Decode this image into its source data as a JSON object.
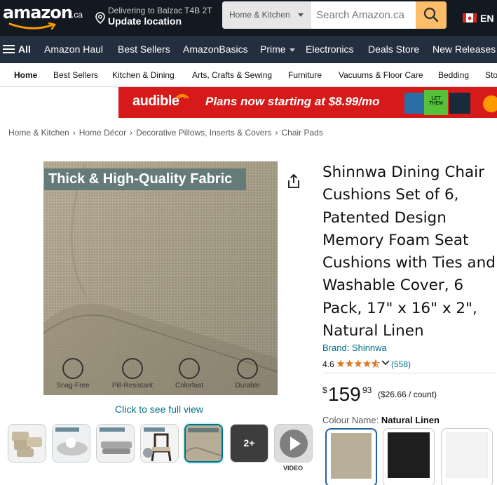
{
  "header": {
    "logo_text": "amazon",
    "logo_tld": ".ca",
    "location_line1": "Delivering to Balzac T4B 2T",
    "location_line2": "Update location",
    "search_category": "Home & Kitchen",
    "search_placeholder": "Search Amazon.ca",
    "language": "EN"
  },
  "nav": {
    "all_label": "All",
    "items": [
      "Amazon Haul",
      "Best Sellers",
      "AmazonBasics",
      "Prime",
      "Electronics",
      "Deals Store",
      "New Releases"
    ]
  },
  "subnav": {
    "items": [
      "Home",
      "Best Sellers",
      "Kitchen & Dining",
      "Arts, Crafts & Sewing",
      "Furniture",
      "Vacuums & Floor Care",
      "Bedding",
      "Sto"
    ]
  },
  "banner": {
    "logo": "audible",
    "text": "Plans now starting at $8.99/mo",
    "book_text": "LET THEM"
  },
  "breadcrumb": [
    "Home & Kitchen",
    "Home Décor",
    "Decorative Pillows, Inserts & Covers",
    "Chair Pads"
  ],
  "gallery": {
    "image_banner": "Thick & High-Quality Fabric",
    "features": [
      "Snag-Free",
      "Pill-Resistant",
      "Colorfast",
      "Durable"
    ],
    "see_full": "Click to see full view",
    "more_count": "2+",
    "video_label": "VIDEO"
  },
  "product": {
    "title": "Shinnwa Dining Chair Cushions Set of 6, Patented Design Memory Foam Seat Cushions with Ties and Washable Cover, 6 Pack, 17\" x 16\" x 2\", Natural Linen",
    "brand": "Brand: Shinnwa",
    "rating": "4.6",
    "rating_stars": 4.6,
    "rating_count": "(558)",
    "price_symbol": "$",
    "price_whole": "159",
    "price_fraction": "93",
    "price_per_unit": "($26.66 / count)",
    "colour_label": "Colour Name:",
    "colour_value": "Natural Linen"
  },
  "colors": {
    "header_bg": "#131921",
    "nav_bg": "#232f3e",
    "search_button": "#febd69",
    "link": "#007185",
    "star": "#de7921",
    "banner_red": "#d61a1a",
    "fabric": "#b5ab93"
  },
  "icons": [
    "location-pin-icon",
    "search-icon",
    "canada-flag-icon",
    "hamburger-icon",
    "share-icon",
    "star-icon",
    "chevron-down-icon",
    "play-icon"
  ]
}
